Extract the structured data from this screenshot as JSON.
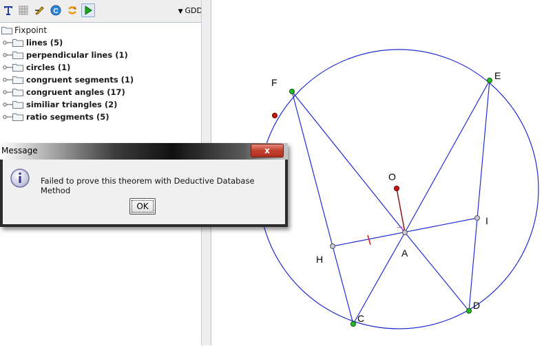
{
  "toolbar": {
    "buttons": [
      {
        "icon": "text-tool-icon"
      },
      {
        "icon": "grid-tool-icon"
      },
      {
        "icon": "edit-tool-icon"
      },
      {
        "icon": "info-tool-icon"
      },
      {
        "icon": "refresh-tool-icon"
      },
      {
        "icon": "play-icon"
      }
    ],
    "method_label": "GDD"
  },
  "tree": {
    "root": "Fixpoint",
    "items": [
      {
        "label": "lines (5)"
      },
      {
        "label": "perpendicular lines (1)"
      },
      {
        "label": "circles (1)"
      },
      {
        "label": "congruent segments (1)"
      },
      {
        "label": "congruent angles (17)"
      },
      {
        "label": "similiar triangles (2)"
      },
      {
        "label": "ratio segments (5)"
      }
    ]
  },
  "dialog": {
    "title": "Message",
    "message": "Failed to prove this theorem with Deductive Database Method",
    "ok_label": "OK",
    "close_label": "x"
  },
  "diagram": {
    "points": [
      "F",
      "E",
      "O",
      "I",
      "A",
      "H",
      "C",
      "D"
    ],
    "colors": {
      "line": "#1f2bd4",
      "green_point": "#22bb22",
      "red_point": "#cc1111",
      "gray_point": "#b8b8c8"
    }
  }
}
